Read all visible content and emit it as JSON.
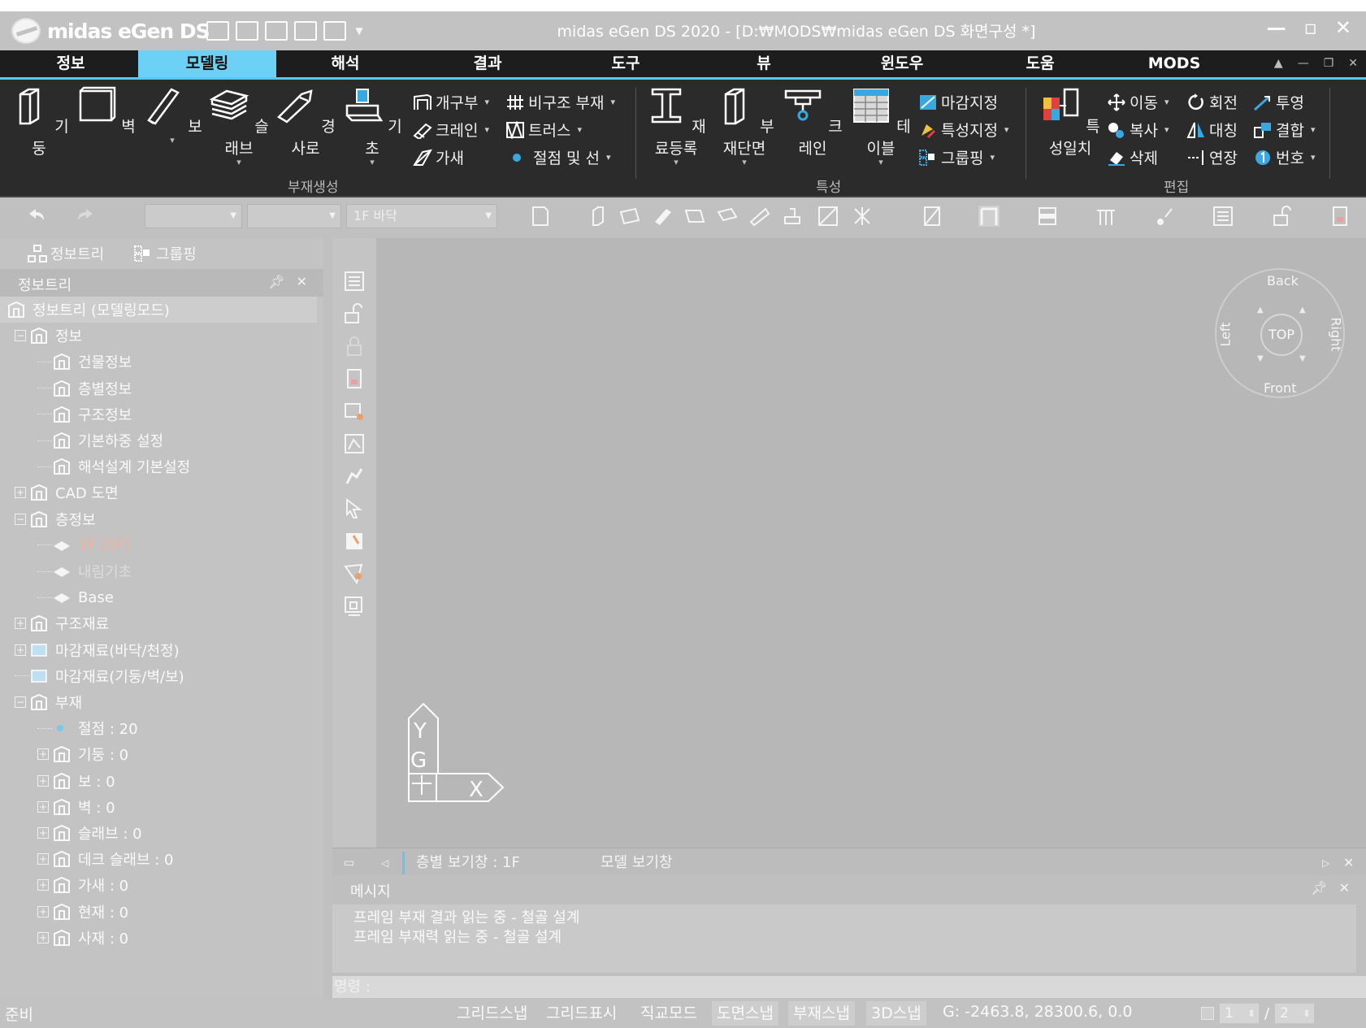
{
  "app": {
    "logo_text": "midas eGen DS",
    "window_title": "midas eGen DS 2020 - [D:₩MODS₩midas eGen DS 화면구성 *]"
  },
  "menu": {
    "items": [
      {
        "label": "정보"
      },
      {
        "label": "모델링"
      },
      {
        "label": "해석"
      },
      {
        "label": "결과"
      },
      {
        "label": "도구"
      },
      {
        "label": "뷰"
      },
      {
        "label": "윈도우"
      },
      {
        "label": "도움"
      },
      {
        "label": "MODS"
      }
    ],
    "active_index": 1
  },
  "ribbon": {
    "member_create": {
      "group_label": "부재생성",
      "big": [
        {
          "label": "기둥",
          "icon": "column-icon"
        },
        {
          "label": "벽",
          "icon": "wall-icon"
        },
        {
          "label": "보",
          "icon": "beam-icon"
        },
        {
          "label": "슬래브",
          "icon": "slab-icon"
        },
        {
          "label": "경사로",
          "icon": "ramp-icon"
        },
        {
          "label": "기초",
          "icon": "foundation-icon"
        }
      ],
      "small": [
        {
          "label": "개구부",
          "icon": "opening-icon"
        },
        {
          "label": "크레인",
          "icon": "crane-small-icon"
        },
        {
          "label": "가새",
          "icon": "brace-icon"
        },
        {
          "label": "비구조 부재",
          "icon": "nonstructural-icon"
        },
        {
          "label": "트러스",
          "icon": "truss-icon"
        },
        {
          "label": "절점 및 선",
          "icon": "node-icon"
        }
      ]
    },
    "property": {
      "group_label": "특성",
      "big": [
        {
          "label": "재료등록",
          "icon": "material-icon"
        },
        {
          "label": "부재단면",
          "icon": "section-icon"
        },
        {
          "label": "크레인",
          "icon": "crane-icon"
        },
        {
          "label": "테이블",
          "icon": "table-icon"
        }
      ],
      "small": [
        {
          "label": "마감지정",
          "icon": "finish-icon"
        },
        {
          "label": "특성지정",
          "icon": "property-assign-icon"
        },
        {
          "label": "그룹핑",
          "icon": "grouping-icon"
        }
      ]
    },
    "edit": {
      "group_label": "편집",
      "big": [
        {
          "label": "특성일치",
          "icon": "match-property-icon"
        }
      ],
      "small": [
        {
          "label": "이동",
          "icon": "move-icon"
        },
        {
          "label": "복사",
          "icon": "copy-icon"
        },
        {
          "label": "삭제",
          "icon": "erase-icon"
        },
        {
          "label": "회전",
          "icon": "rotate-icon"
        },
        {
          "label": "대칭",
          "icon": "mirror-icon"
        },
        {
          "label": "연장",
          "icon": "extend-icon"
        },
        {
          "label": "투영",
          "icon": "project-icon"
        },
        {
          "label": "결합",
          "icon": "join-icon"
        },
        {
          "label": "번호",
          "icon": "number-icon"
        }
      ]
    }
  },
  "toolbar": {
    "floor_combo": "1F 바닥"
  },
  "left_panel": {
    "tabs": [
      {
        "label": "정보트리"
      },
      {
        "label": "그룹핑"
      }
    ],
    "header_title": "정보트리",
    "pin_icon": "pin-icon",
    "close_icon": "close-icon",
    "tree": [
      {
        "label": "정보트리 (모델링모드)",
        "icon": "tree-root-icon"
      },
      {
        "label": "정보",
        "icon": "building-icon",
        "toggle": "⊟"
      },
      {
        "label": "건물정보",
        "icon": "building-icon"
      },
      {
        "label": "층별정보",
        "icon": "floor-icon"
      },
      {
        "label": "구조정보",
        "icon": "structure-icon"
      },
      {
        "label": "기본하중 설정",
        "icon": "load-icon"
      },
      {
        "label": "해석설계 기본설정",
        "icon": "analysis-settings-icon"
      },
      {
        "label": "CAD 도면",
        "icon": "cad-icon",
        "toggle": "⊞"
      },
      {
        "label": "층정보",
        "icon": "floor-icon",
        "toggle": "⊟"
      },
      {
        "label": "1F [1F]",
        "icon": "layer-icon"
      },
      {
        "label": "내림기초",
        "icon": "layer-icon"
      },
      {
        "label": "Base",
        "icon": "layer-icon"
      },
      {
        "label": "구조재료",
        "icon": "material-icon",
        "toggle": "⊞"
      },
      {
        "label": "마감재료(바닥/천정)",
        "icon": "finish-floor-icon",
        "toggle": "⊞"
      },
      {
        "label": "마감재료(기둥/벽/보)",
        "icon": "finish-wall-icon"
      },
      {
        "label": "부재",
        "icon": "member-icon",
        "toggle": "⊟"
      },
      {
        "label": "절점 : 20",
        "icon": "node-dot-icon"
      },
      {
        "label": "기둥 : 0",
        "icon": "column-icon",
        "toggle": "⊞"
      },
      {
        "label": "보 : 0",
        "icon": "beam-icon",
        "toggle": "⊞"
      },
      {
        "label": "벽 : 0",
        "icon": "wall-icon",
        "toggle": "⊞"
      },
      {
        "label": "슬래브 : 0",
        "icon": "slab-icon",
        "toggle": "⊞"
      },
      {
        "label": "데크 슬래브 : 0",
        "icon": "deck-slab-icon",
        "toggle": "⊞"
      },
      {
        "label": "가새 : 0",
        "icon": "brace-icon",
        "toggle": "⊞"
      },
      {
        "label": "현재 : 0",
        "icon": "truss-icon",
        "toggle": "⊞"
      },
      {
        "label": "사재 : 0",
        "icon": "truss-icon",
        "toggle": "⊞"
      }
    ]
  },
  "viewport": {
    "navcube": {
      "back": "Back",
      "front": "Front",
      "left": "Left",
      "right": "Right",
      "top": "TOP"
    },
    "ucs": {
      "y": "Y",
      "g": "G",
      "x": "X"
    }
  },
  "view_tabs": [
    {
      "label": "층별 보기창 : 1F"
    },
    {
      "label": "모델 보기창"
    }
  ],
  "messages": {
    "title": "메시지",
    "lines": [
      "프레임 부재 결과 읽는 중 - 철골 설계",
      "프레임 부재력 읽는 중 - 철골 설계"
    ],
    "command_label": "명령 :"
  },
  "status": {
    "ready": "준비",
    "toggles": [
      {
        "label": "그리드스냅",
        "on": false
      },
      {
        "label": "그리드표시",
        "on": false
      },
      {
        "label": "직교모드",
        "on": false
      },
      {
        "label": "도면스냅",
        "on": true
      },
      {
        "label": "부재스냅",
        "on": true
      },
      {
        "label": "3D스냅",
        "on": true
      }
    ],
    "coords": "G: -2463.8, 28300.6, 0.0",
    "page_current": "1",
    "page_sep": "/",
    "page_total": "2"
  },
  "colors": {
    "menu_active": "#6dd0f5",
    "ribbon_bg": "#2b2b2b",
    "highlight_text": "#f0b09a"
  }
}
